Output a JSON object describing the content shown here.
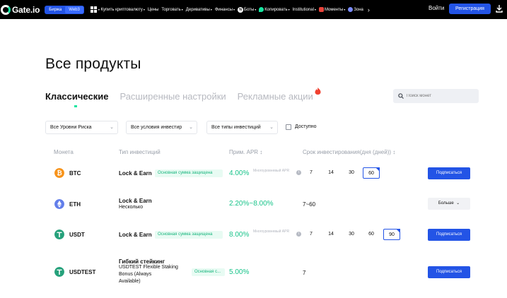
{
  "header": {
    "logo_text": "Gate.io",
    "segments": [
      "Биржа",
      "Web3"
    ],
    "nav": [
      {
        "label": "Купить криптовалюту",
        "caret": true
      },
      {
        "label": "Цены",
        "caret": false
      },
      {
        "label": "Торговать",
        "caret": true
      },
      {
        "label": "Деривативы",
        "caret": true
      },
      {
        "label": "Финансы",
        "caret": true
      },
      {
        "label": "Боты",
        "caret": true
      },
      {
        "label": "Копировать",
        "caret": true
      },
      {
        "label": "Institutional",
        "caret": true
      },
      {
        "label": "Моменты",
        "caret": true
      },
      {
        "label": "Зона",
        "caret": false
      }
    ],
    "login": "Войти",
    "register": "Регистрация",
    "icons": [
      "grid-icon",
      "gate-logo-icon",
      "new-badge-icon",
      "copy-trade-icon",
      "moments-icon",
      "zone-icon",
      "chevron-right-icon",
      "download-icon"
    ]
  },
  "page": {
    "title": "Все продукты"
  },
  "tabs": [
    "Классические",
    "Расширенные настройки",
    "Рекламные акции"
  ],
  "search": {
    "placeholder": "Поиск монет"
  },
  "filters": {
    "risk": "Все Уровни Риска",
    "conditions": "Все условия инвестир",
    "types": "Все типы инвестиций",
    "available": "Доступно"
  },
  "table": {
    "headers": {
      "coin": "Монета",
      "type": "Тип инвестиций",
      "apr": "Прим. APR ↕",
      "term": "Срок инвестирования(дня (дней)) ↕"
    },
    "rows": [
      {
        "coin": "BTC",
        "type": "Lock & Earn",
        "type_sub": "",
        "tag": "Основная сумма защищена",
        "apr": "4.00%",
        "apr_note": "Многоуровневый APR",
        "terms": [
          "7",
          "14",
          "30",
          "60"
        ],
        "selected_term": "60",
        "action": "Подписаться"
      },
      {
        "coin": "ETH",
        "type": "Lock & Earn",
        "type_sub": "Несколько",
        "tag": "",
        "apr": "2.20%~8.00%",
        "apr_note": "",
        "term_text": "7~60",
        "action": "Больше"
      },
      {
        "coin": "USDT",
        "type": "Lock & Earn",
        "type_sub": "",
        "tag": "Основная сумма защищена",
        "apr": "8.00%",
        "apr_note": "Многоуровневый APR",
        "terms": [
          "7",
          "14",
          "30",
          "60",
          "90"
        ],
        "selected_term": "90",
        "action": "Подписаться"
      },
      {
        "coin": "USDTEST",
        "type": "Гибкий стейкинг",
        "type_sub_lines": [
          "USDTEST Flexible Staking",
          "Bonus (Always",
          "Available)"
        ],
        "tag": "Основная с...",
        "apr": "5.00%",
        "term_text": "7",
        "action": "Подписаться"
      }
    ]
  },
  "colors": {
    "accent": "#2354e6",
    "apr_green": "#17c389",
    "btc": "#f7931a",
    "eth": "#627eea",
    "usdt": "#26a17b"
  }
}
